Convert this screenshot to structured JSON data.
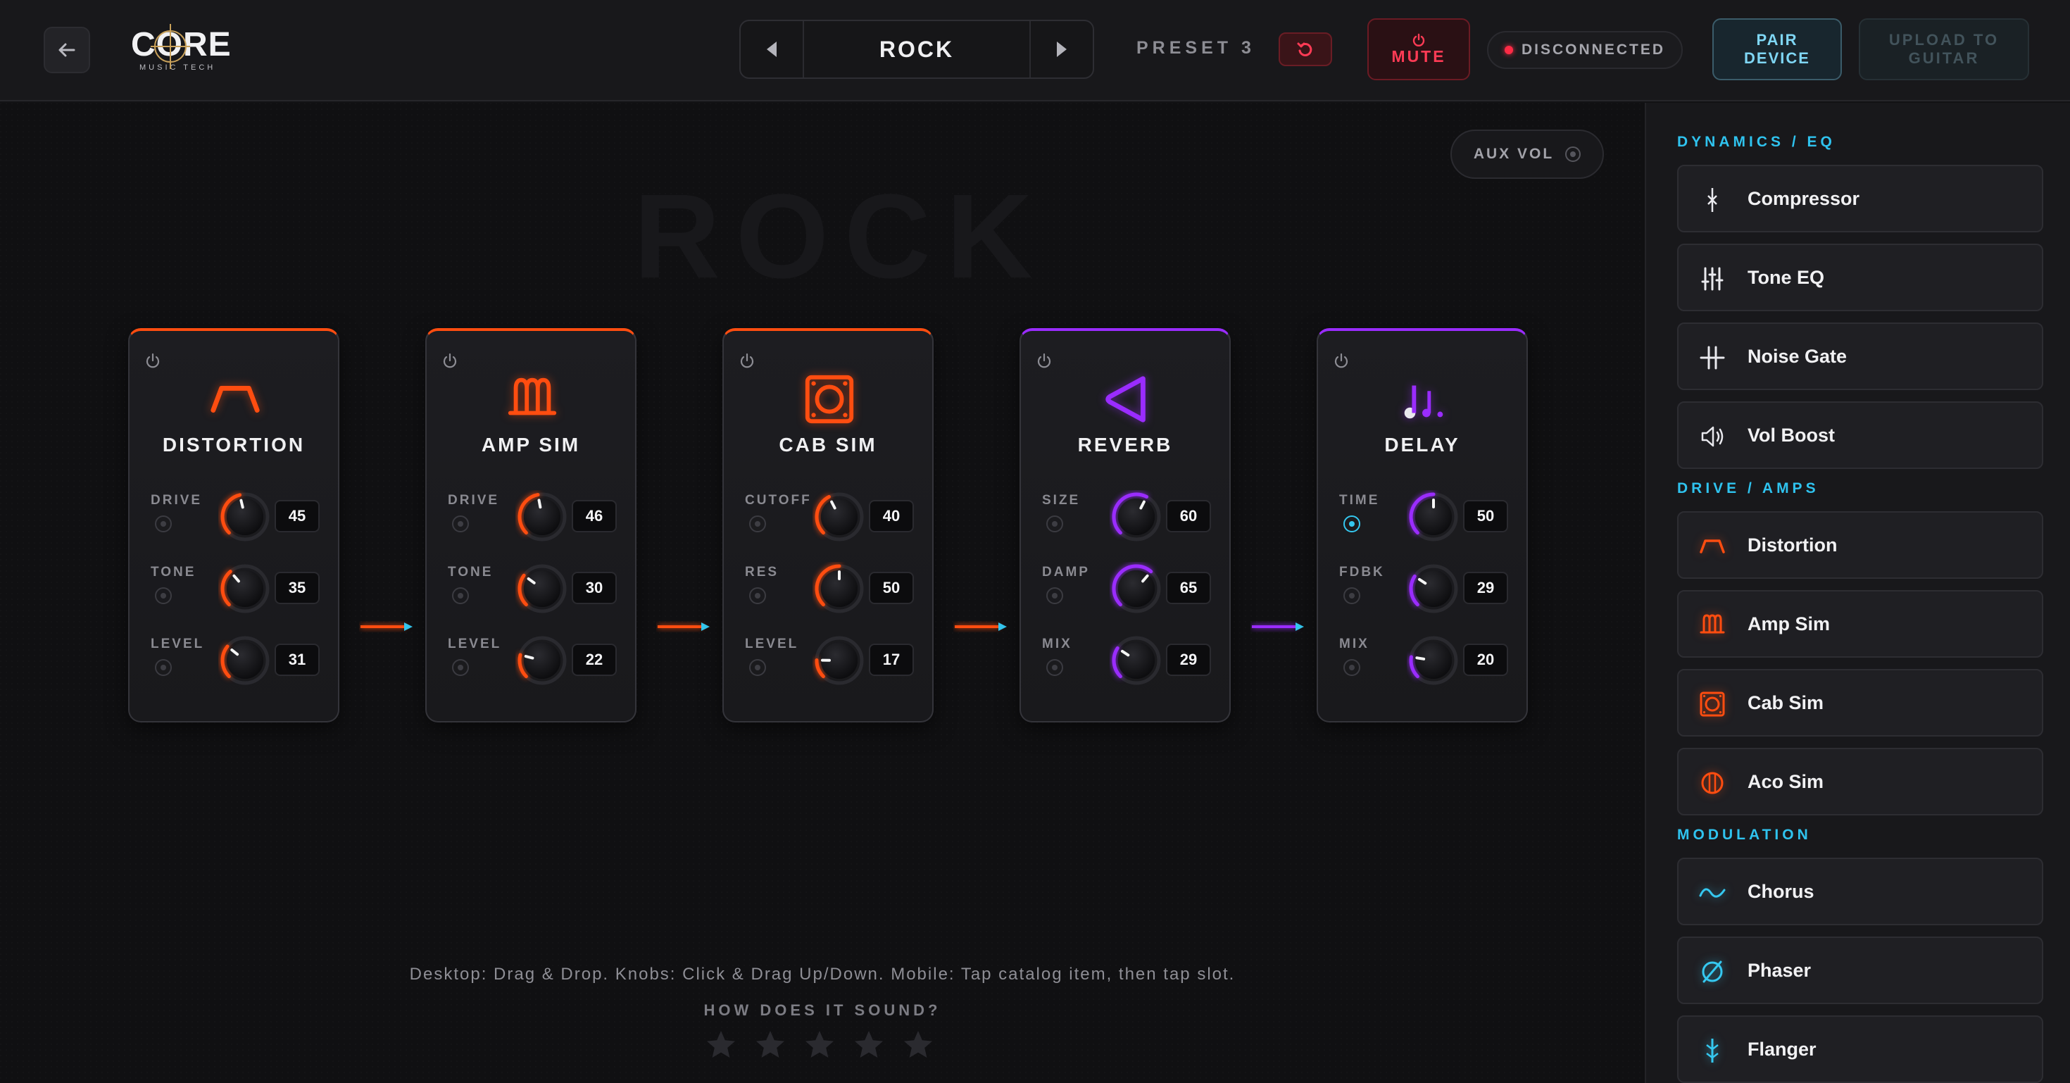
{
  "header": {
    "logo_text": "CORE",
    "logo_sub": "MUSIC TECH",
    "preset_name": "ROCK",
    "preset_number": "PRESET 3",
    "mute_label": "MUTE",
    "status_text": "DISCONNECTED",
    "pair_label": "PAIR DEVICE",
    "upload_label": "UPLOAD TO GUITAR",
    "icons": [
      "arrow-left-icon",
      "chevron-left-icon",
      "chevron-right-icon",
      "reset-icon",
      "power-icon"
    ]
  },
  "main": {
    "aux_label": "AUX VOL",
    "watermark": "ROCK",
    "instructions": "Desktop: Drag & Drop. Knobs: Click & Drag Up/Down. Mobile: Tap catalog item, then tap slot.",
    "rating_label": "HOW DOES IT SOUND?",
    "rating_stars_filled": 0,
    "rating_stars_total": 5
  },
  "colors": {
    "drive_accent": "#ff4d10",
    "time_accent": "#9a2cff",
    "section_accent": "#2fc3ef",
    "mute_red": "#ff3b55"
  },
  "pedals": [
    {
      "title": "DISTORTION",
      "accent": "orange",
      "icon": "distortion-icon",
      "params": [
        {
          "label": "DRIVE",
          "value": "45"
        },
        {
          "label": "TONE",
          "value": "35"
        },
        {
          "label": "LEVEL",
          "value": "31"
        }
      ]
    },
    {
      "title": "AMP SIM",
      "accent": "orange",
      "icon": "amp-sim-icon",
      "params": [
        {
          "label": "DRIVE",
          "value": "46"
        },
        {
          "label": "TONE",
          "value": "30"
        },
        {
          "label": "LEVEL",
          "value": "22"
        }
      ]
    },
    {
      "title": "CAB SIM",
      "accent": "orange",
      "icon": "cab-sim-icon",
      "params": [
        {
          "label": "CUTOFF",
          "value": "40"
        },
        {
          "label": "RES",
          "value": "50"
        },
        {
          "label": "LEVEL",
          "value": "17"
        }
      ]
    },
    {
      "title": "REVERB",
      "accent": "purple",
      "icon": "reverb-icon",
      "params": [
        {
          "label": "SIZE",
          "value": "60"
        },
        {
          "label": "DAMP",
          "value": "65"
        },
        {
          "label": "MIX",
          "value": "29"
        }
      ]
    },
    {
      "title": "DELAY",
      "accent": "purple",
      "icon": "delay-icon",
      "params": [
        {
          "label": "TIME",
          "value": "50"
        },
        {
          "label": "FDBK",
          "value": "29"
        },
        {
          "label": "MIX",
          "value": "20"
        }
      ]
    }
  ],
  "catalog": {
    "sections": [
      {
        "title": "DYNAMICS / EQ",
        "items": [
          {
            "label": "Compressor",
            "icon": "compressor-icon"
          },
          {
            "label": "Tone EQ",
            "icon": "eq-sliders-icon"
          },
          {
            "label": "Noise Gate",
            "icon": "noise-gate-icon"
          },
          {
            "label": "Vol Boost",
            "icon": "speaker-icon"
          }
        ]
      },
      {
        "title": "DRIVE / AMPS",
        "items": [
          {
            "label": "Distortion",
            "icon": "distortion-icon"
          },
          {
            "label": "Amp Sim",
            "icon": "amp-sim-icon"
          },
          {
            "label": "Cab Sim",
            "icon": "cab-sim-icon"
          },
          {
            "label": "Aco Sim",
            "icon": "aco-sim-icon"
          }
        ]
      },
      {
        "title": "MODULATION",
        "items": [
          {
            "label": "Chorus",
            "icon": "wave-icon"
          },
          {
            "label": "Phaser",
            "icon": "phaser-icon"
          },
          {
            "label": "Flanger",
            "icon": "flanger-icon"
          }
        ]
      }
    ]
  }
}
